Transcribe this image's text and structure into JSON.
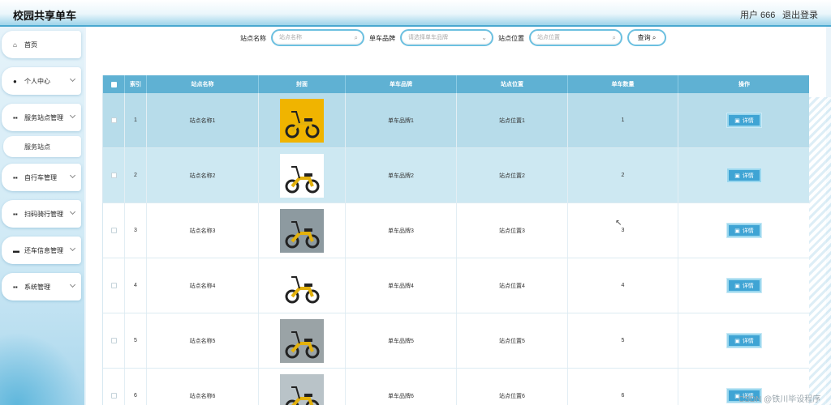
{
  "header": {
    "title": "校园共享单车",
    "user": "用户 666",
    "logout": "退出登录"
  },
  "sidebar": {
    "items": [
      {
        "label": "首页",
        "icon": "home-icon",
        "glyph": "⌂",
        "expandable": false
      },
      {
        "label": "个人中心",
        "icon": "user-icon",
        "glyph": "●",
        "expandable": true
      },
      {
        "label": "服务站点管理",
        "icon": "grid-icon",
        "glyph": "▪▪",
        "expandable": true
      },
      {
        "label": "自行车管理",
        "icon": "grid-icon",
        "glyph": "▪▪",
        "expandable": true
      },
      {
        "label": "扫码骑行管理",
        "icon": "grid-icon",
        "glyph": "▪▪",
        "expandable": true
      },
      {
        "label": "还车信息管理",
        "icon": "briefcase-icon",
        "glyph": "▬",
        "expandable": true
      },
      {
        "label": "系统管理",
        "icon": "grid-icon",
        "glyph": "▪▪",
        "expandable": true
      }
    ],
    "sub_item": "服务站点"
  },
  "search": {
    "station_label": "站点名称",
    "station_placeholder": "站点名称",
    "brand_label": "单车品牌",
    "brand_placeholder": "请选择单车品牌",
    "location_label": "站点位置",
    "location_placeholder": "站点位置",
    "query_button": "查询"
  },
  "table": {
    "headers": {
      "index": "索引",
      "name": "站点名称",
      "cover": "封面",
      "brand": "单车品牌",
      "location": "站点位置",
      "count": "单车数量",
      "action": "操作"
    },
    "rows": [
      {
        "index": "1",
        "name": "站点名称1",
        "brand": "单车品牌1",
        "location": "站点位置1",
        "count": "1",
        "action": "详情",
        "row_bg": "#b7dcea"
      },
      {
        "index": "2",
        "name": "站点名称2",
        "brand": "单车品牌2",
        "location": "站点位置2",
        "count": "2",
        "action": "详情",
        "row_bg": "#cde8f2"
      },
      {
        "index": "3",
        "name": "站点名称3",
        "brand": "单车品牌3",
        "location": "站点位置3",
        "count": "3",
        "action": "详情",
        "row_bg": "#ffffff"
      },
      {
        "index": "4",
        "name": "站点名称4",
        "brand": "单车品牌4",
        "location": "站点位置4",
        "count": "4",
        "action": "详情",
        "row_bg": "#ffffff"
      },
      {
        "index": "5",
        "name": "站点名称5",
        "brand": "单车品牌5",
        "location": "站点位置5",
        "count": "5",
        "action": "详情",
        "row_bg": "#ffffff"
      },
      {
        "index": "6",
        "name": "站点名称6",
        "brand": "单车品牌6",
        "location": "站点位置6",
        "count": "6",
        "action": "详情",
        "row_bg": "#ffffff"
      }
    ]
  },
  "watermark": "CSDN @铁川毕设程序",
  "colors": {
    "accent": "#3fa4d4",
    "header_bg": "#5fb1d3",
    "input_border": "#6cc0e0"
  }
}
